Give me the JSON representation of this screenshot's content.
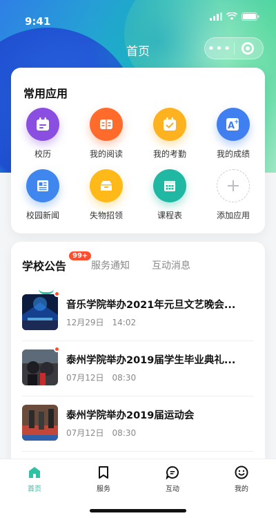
{
  "status": {
    "time": "9:41"
  },
  "nav": {
    "title": "首页"
  },
  "apps": {
    "title": "常用应用",
    "items": [
      {
        "label": "校历",
        "icon": "calendar-icon",
        "color": "#8a4fe0"
      },
      {
        "label": "我的阅读",
        "icon": "book-icon",
        "color": "#ff6b2b"
      },
      {
        "label": "我的考勤",
        "icon": "attendance-check-icon",
        "color": "#ffb21f"
      },
      {
        "label": "我的成绩",
        "icon": "grade-a-plus-icon",
        "color": "#3f7ff0"
      },
      {
        "label": "校园新闻",
        "icon": "newspaper-icon",
        "color": "#3f86ef"
      },
      {
        "label": "失物招领",
        "icon": "lost-found-box-icon",
        "color": "#ffba1a"
      },
      {
        "label": "课程表",
        "icon": "timetable-icon",
        "color": "#20b8a2"
      },
      {
        "label": "添加应用",
        "icon": "plus-icon",
        "color": "#c9cdd3"
      }
    ]
  },
  "news": {
    "tabs": [
      {
        "label": "学校公告",
        "badge": "99+"
      },
      {
        "label": "服务通知"
      },
      {
        "label": "互动消息"
      }
    ],
    "items": [
      {
        "title": "音乐学院举办2021年元旦文艺晚会...",
        "date": "12月29日",
        "time": "14:02",
        "unread": true
      },
      {
        "title": "泰州学院举办2019届学生毕业典礼...",
        "date": "07月12日",
        "time": "08:30",
        "unread": true
      },
      {
        "title": "泰州学院举办2019届运动会",
        "date": "07月12日",
        "time": "08:30",
        "unread": false
      }
    ]
  },
  "tabbar": {
    "accent": "#2cc2a3",
    "items": [
      {
        "label": "首页",
        "icon": "home-icon"
      },
      {
        "label": "服务",
        "icon": "bookmark-icon"
      },
      {
        "label": "互动",
        "icon": "chat-icon"
      },
      {
        "label": "我的",
        "icon": "smile-icon"
      }
    ]
  }
}
